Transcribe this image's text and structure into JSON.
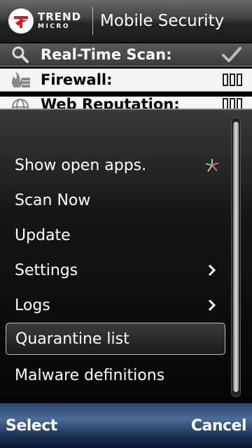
{
  "header": {
    "logo_line1": "TREND",
    "logo_line2": "MICRO",
    "title": "Mobile Security"
  },
  "status_rows": [
    {
      "label": "Real-Time Scan:",
      "icon": "magnifier-icon",
      "status": "checkmark"
    },
    {
      "label": "Firewall:",
      "icon": "firewall-icon",
      "status": "three-bars"
    },
    {
      "label": "Web Reputation:",
      "icon": "globe-icon",
      "status": "three-bars"
    }
  ],
  "menu": {
    "items": [
      {
        "label": "Show open apps.",
        "right_icon": "multitask-icon"
      },
      {
        "label": "Scan Now"
      },
      {
        "label": "Update"
      },
      {
        "label": "Settings",
        "right_icon": "chevron-right-icon"
      },
      {
        "label": "Logs",
        "right_icon": "chevron-right-icon"
      },
      {
        "label": "Quarantine list",
        "selected": true
      },
      {
        "label": "Malware definitions"
      }
    ]
  },
  "softkeys": {
    "left": "Select",
    "right": "Cancel"
  },
  "colors": {
    "menu_background": "#0a0a0a",
    "softkey_bar": "#3a5a88",
    "multitask_icon": [
      "#e85a9c",
      "#5ac8e8",
      "#f0c040",
      "#80e060"
    ]
  }
}
